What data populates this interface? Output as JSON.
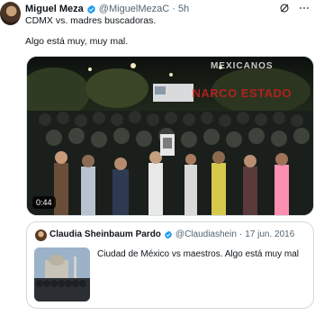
{
  "post": {
    "author_name": "Miguel Meza",
    "handle": "@MiguelMezaC",
    "separator": "·",
    "time": "5h",
    "text_line1": "CDMX vs. madres buscadoras.",
    "text_line2": "Algo está muy, muy mal.",
    "media": {
      "duration": "0:44",
      "watermark_top": "MEXICANOS",
      "watermark_bottom": "NARCO ESTADO"
    }
  },
  "quoted": {
    "author_name": "Claudia Sheinbaum Pardo",
    "handle": "@Claudiashein",
    "separator": "·",
    "date": "17 jun. 2016",
    "text": "Ciudad de México vs maestros. Algo está muy mal"
  },
  "icons": {
    "verified": "verified-badge-icon",
    "grok": "grok-icon",
    "more": "more-options-icon"
  },
  "colors": {
    "verified": "#1d9bf0",
    "text": "#0f1419",
    "secondary": "#536471"
  }
}
